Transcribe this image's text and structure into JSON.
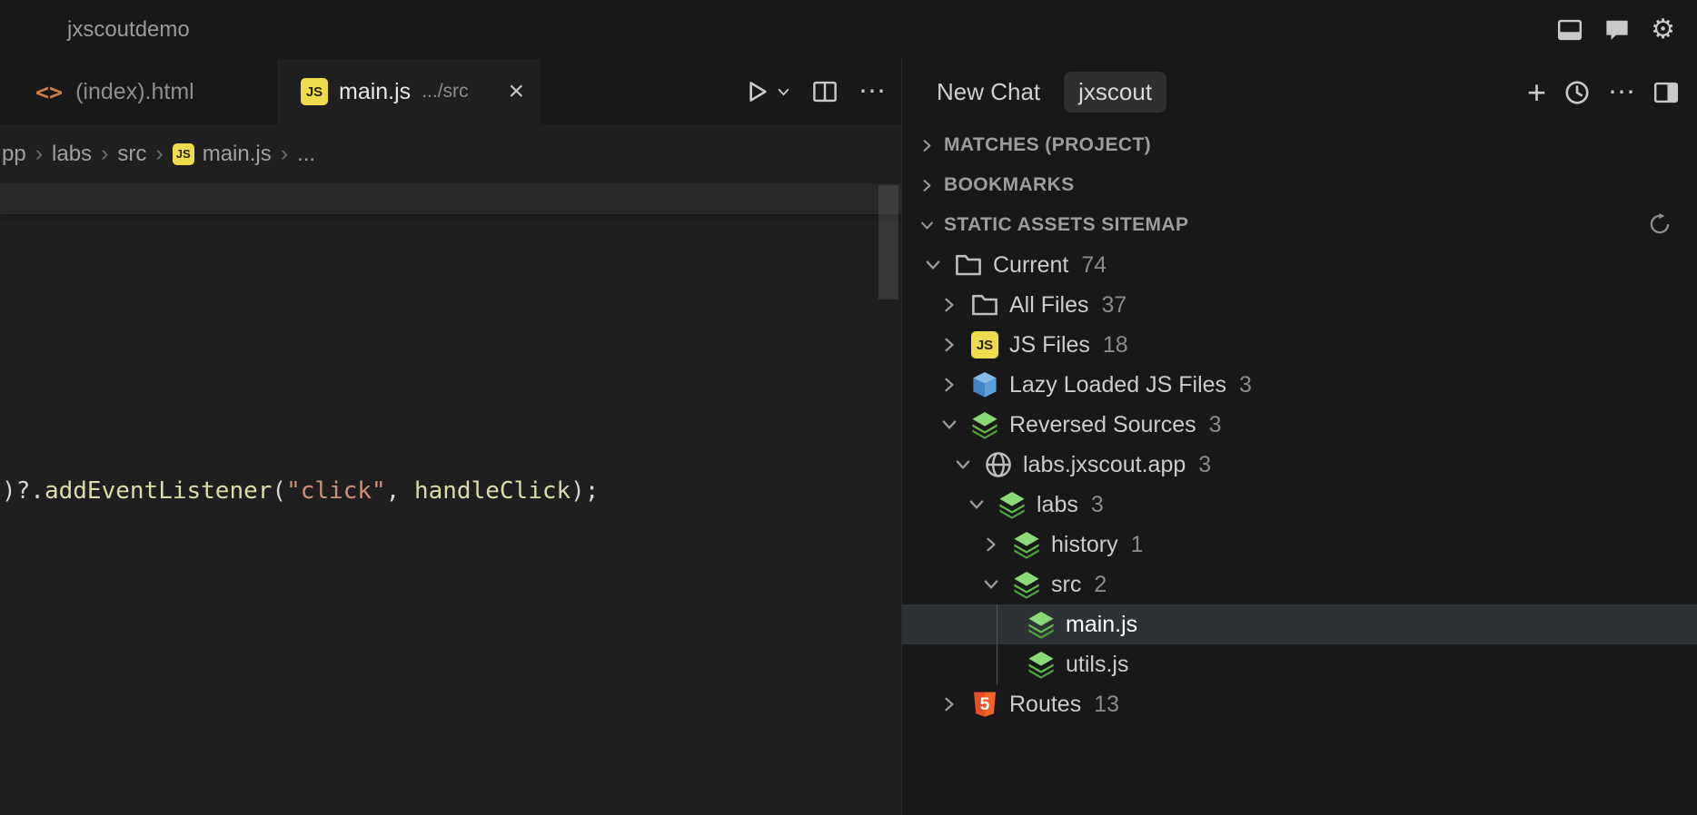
{
  "titlebar": {
    "title": "jxscoutdemo"
  },
  "glyphs": {
    "html_tab": "<>",
    "js_badge": "JS",
    "close": "×",
    "more": "⋯",
    "plus": "+",
    "gear": "⚙",
    "separator": "›",
    "five": "5"
  },
  "tabs": {
    "index_html": {
      "label": "(index).html"
    },
    "main_js": {
      "label": "main.js",
      "detail": ".../src"
    }
  },
  "breadcrumb": {
    "items": [
      "pp",
      "labs",
      "src",
      "main.js",
      "..."
    ]
  },
  "code": {
    "tokens": [
      {
        "text": ")?.",
        "color": "#d4d4d4"
      },
      {
        "text": "addEventListener",
        "color": "#dcdcaa"
      },
      {
        "text": "(",
        "color": "#d4d4d4"
      },
      {
        "text": "\"click\"",
        "color": "#ce9178"
      },
      {
        "text": ", ",
        "color": "#d4d4d4"
      },
      {
        "text": "handleClick",
        "color": "#dcdcaa"
      },
      {
        "text": ");",
        "color": "#d4d4d4"
      }
    ]
  },
  "panel": {
    "header": {
      "new_chat": "New Chat",
      "title": "jxscout"
    },
    "sections": {
      "matches": {
        "label": "MATCHES (PROJECT)",
        "state": "collapsed"
      },
      "bookmarks": {
        "label": "BOOKMARKS",
        "state": "collapsed"
      },
      "sitemap": {
        "label": "STATIC ASSETS SITEMAP",
        "state": "expanded"
      }
    },
    "tree": {
      "current": {
        "label": "Current",
        "count": "74",
        "icon": "folder-icon",
        "state": "expanded"
      },
      "all_files": {
        "label": "All Files",
        "count": "37",
        "icon": "folder-icon",
        "state": "collapsed"
      },
      "js_files": {
        "label": "JS Files",
        "count": "18",
        "icon": "js-icon",
        "state": "collapsed"
      },
      "lazy": {
        "label": "Lazy Loaded JS Files",
        "count": "3",
        "icon": "cube-icon",
        "state": "collapsed"
      },
      "reversed": {
        "label": "Reversed Sources",
        "count": "3",
        "icon": "layers-green-icon",
        "state": "expanded"
      },
      "domain": {
        "label": "labs.jxscout.app",
        "count": "3",
        "icon": "globe-icon",
        "state": "expanded"
      },
      "labs": {
        "label": "labs",
        "count": "3",
        "icon": "layers-green-icon",
        "state": "expanded"
      },
      "history": {
        "label": "history",
        "count": "1",
        "icon": "layers-green-icon",
        "state": "collapsed"
      },
      "src": {
        "label": "src",
        "count": "2",
        "icon": "layers-green-icon",
        "state": "expanded"
      },
      "main_js": {
        "label": "main.js",
        "icon": "layers-green-icon",
        "selected": true
      },
      "utils_js": {
        "label": "utils.js",
        "icon": "layers-green-icon",
        "selected": false
      },
      "routes": {
        "label": "Routes",
        "count": "13",
        "icon": "html5-icon",
        "state": "collapsed"
      }
    }
  },
  "colors": {
    "window_bg": "#181818",
    "editor_bg": "#1f1f1f",
    "sticky_band": "#282828",
    "selected_row": "#2f3234",
    "text": "#cccccc",
    "dim_text": "#9d9d9d",
    "count_text": "#8a8a8a",
    "js_yellow": "#f0db4f",
    "jxscout_green": "#63b94c",
    "cube_blue": "#4a90d4",
    "html5_orange": "#e44d26",
    "code_string": "#ce9178",
    "code_function": "#dcdcaa",
    "code_plain": "#d4d4d4"
  }
}
